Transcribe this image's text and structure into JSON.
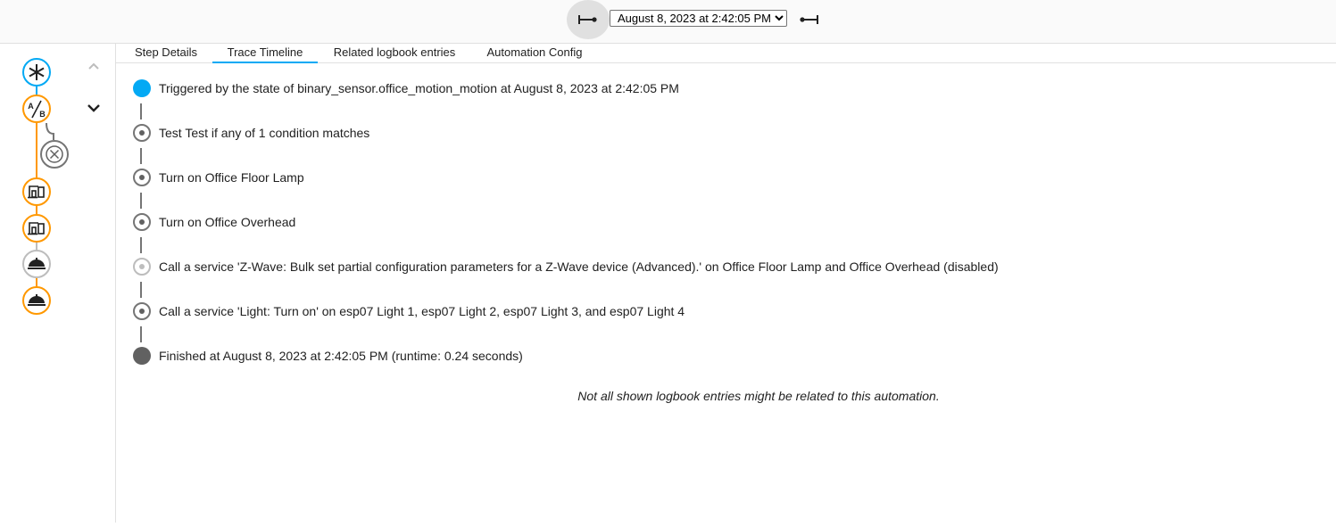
{
  "toolbar": {
    "prev_icon": "arrow-left-bar-icon",
    "next_icon": "arrow-right-bar-icon",
    "selected_trace": "August 8, 2023 at 2:42:05 PM",
    "trace_options": [
      "August 8, 2023 at 2:42:05 PM"
    ]
  },
  "graph": {
    "nodes": [
      {
        "name": "trigger-node",
        "icon": "asterisk-icon",
        "color": "#03a9f4"
      },
      {
        "name": "choose-node",
        "icon": "a-b-choose-icon",
        "color": "#ff9800"
      },
      {
        "name": "condition-not-taken-node",
        "icon": "close-circle-icon",
        "color": "#757575"
      },
      {
        "name": "device-node-1",
        "icon": "devices-icon",
        "color": "#ff9800"
      },
      {
        "name": "device-node-2",
        "icon": "devices-icon",
        "color": "#ff9800"
      },
      {
        "name": "service-node-disabled",
        "icon": "room-service-icon",
        "color": "#bdbdbd"
      },
      {
        "name": "service-node",
        "icon": "room-service-icon",
        "color": "#ff9800"
      }
    ],
    "collapse_icon": "chevron-up-icon",
    "expand_icon": "chevron-down-icon"
  },
  "tabs": [
    "Step Details",
    "Trace Timeline",
    "Related logbook entries",
    "Automation Config"
  ],
  "active_tab": "Trace Timeline",
  "timeline": [
    {
      "type": "trigger",
      "text": "Triggered by the state of binary_sensor.office_motion_motion at August 8, 2023 at 2:42:05 PM"
    },
    {
      "type": "step",
      "text": "Test Test if any of 1 condition matches"
    },
    {
      "type": "step",
      "text": "Turn on Office Floor Lamp"
    },
    {
      "type": "step",
      "text": "Turn on Office Overhead"
    },
    {
      "type": "disabled",
      "text": "Call a service 'Z-Wave: Bulk set partial configuration parameters for a Z-Wave device (Advanced).' on Office Floor Lamp and Office Overhead (disabled)"
    },
    {
      "type": "step",
      "text": "Call a service 'Light: Turn on' on esp07 Light 1, esp07 Light 2, esp07 Light 3, and esp07 Light 4"
    },
    {
      "type": "finished",
      "text": "Finished at August 8, 2023 at 2:42:05 PM (runtime: 0.24 seconds)"
    }
  ],
  "note": "Not all shown logbook entries might be related to this automation.",
  "colors": {
    "accent": "#03a9f4",
    "choose": "#ff9800",
    "step": "#757575",
    "disabled": "#bdbdbd",
    "finished": "#616161"
  }
}
